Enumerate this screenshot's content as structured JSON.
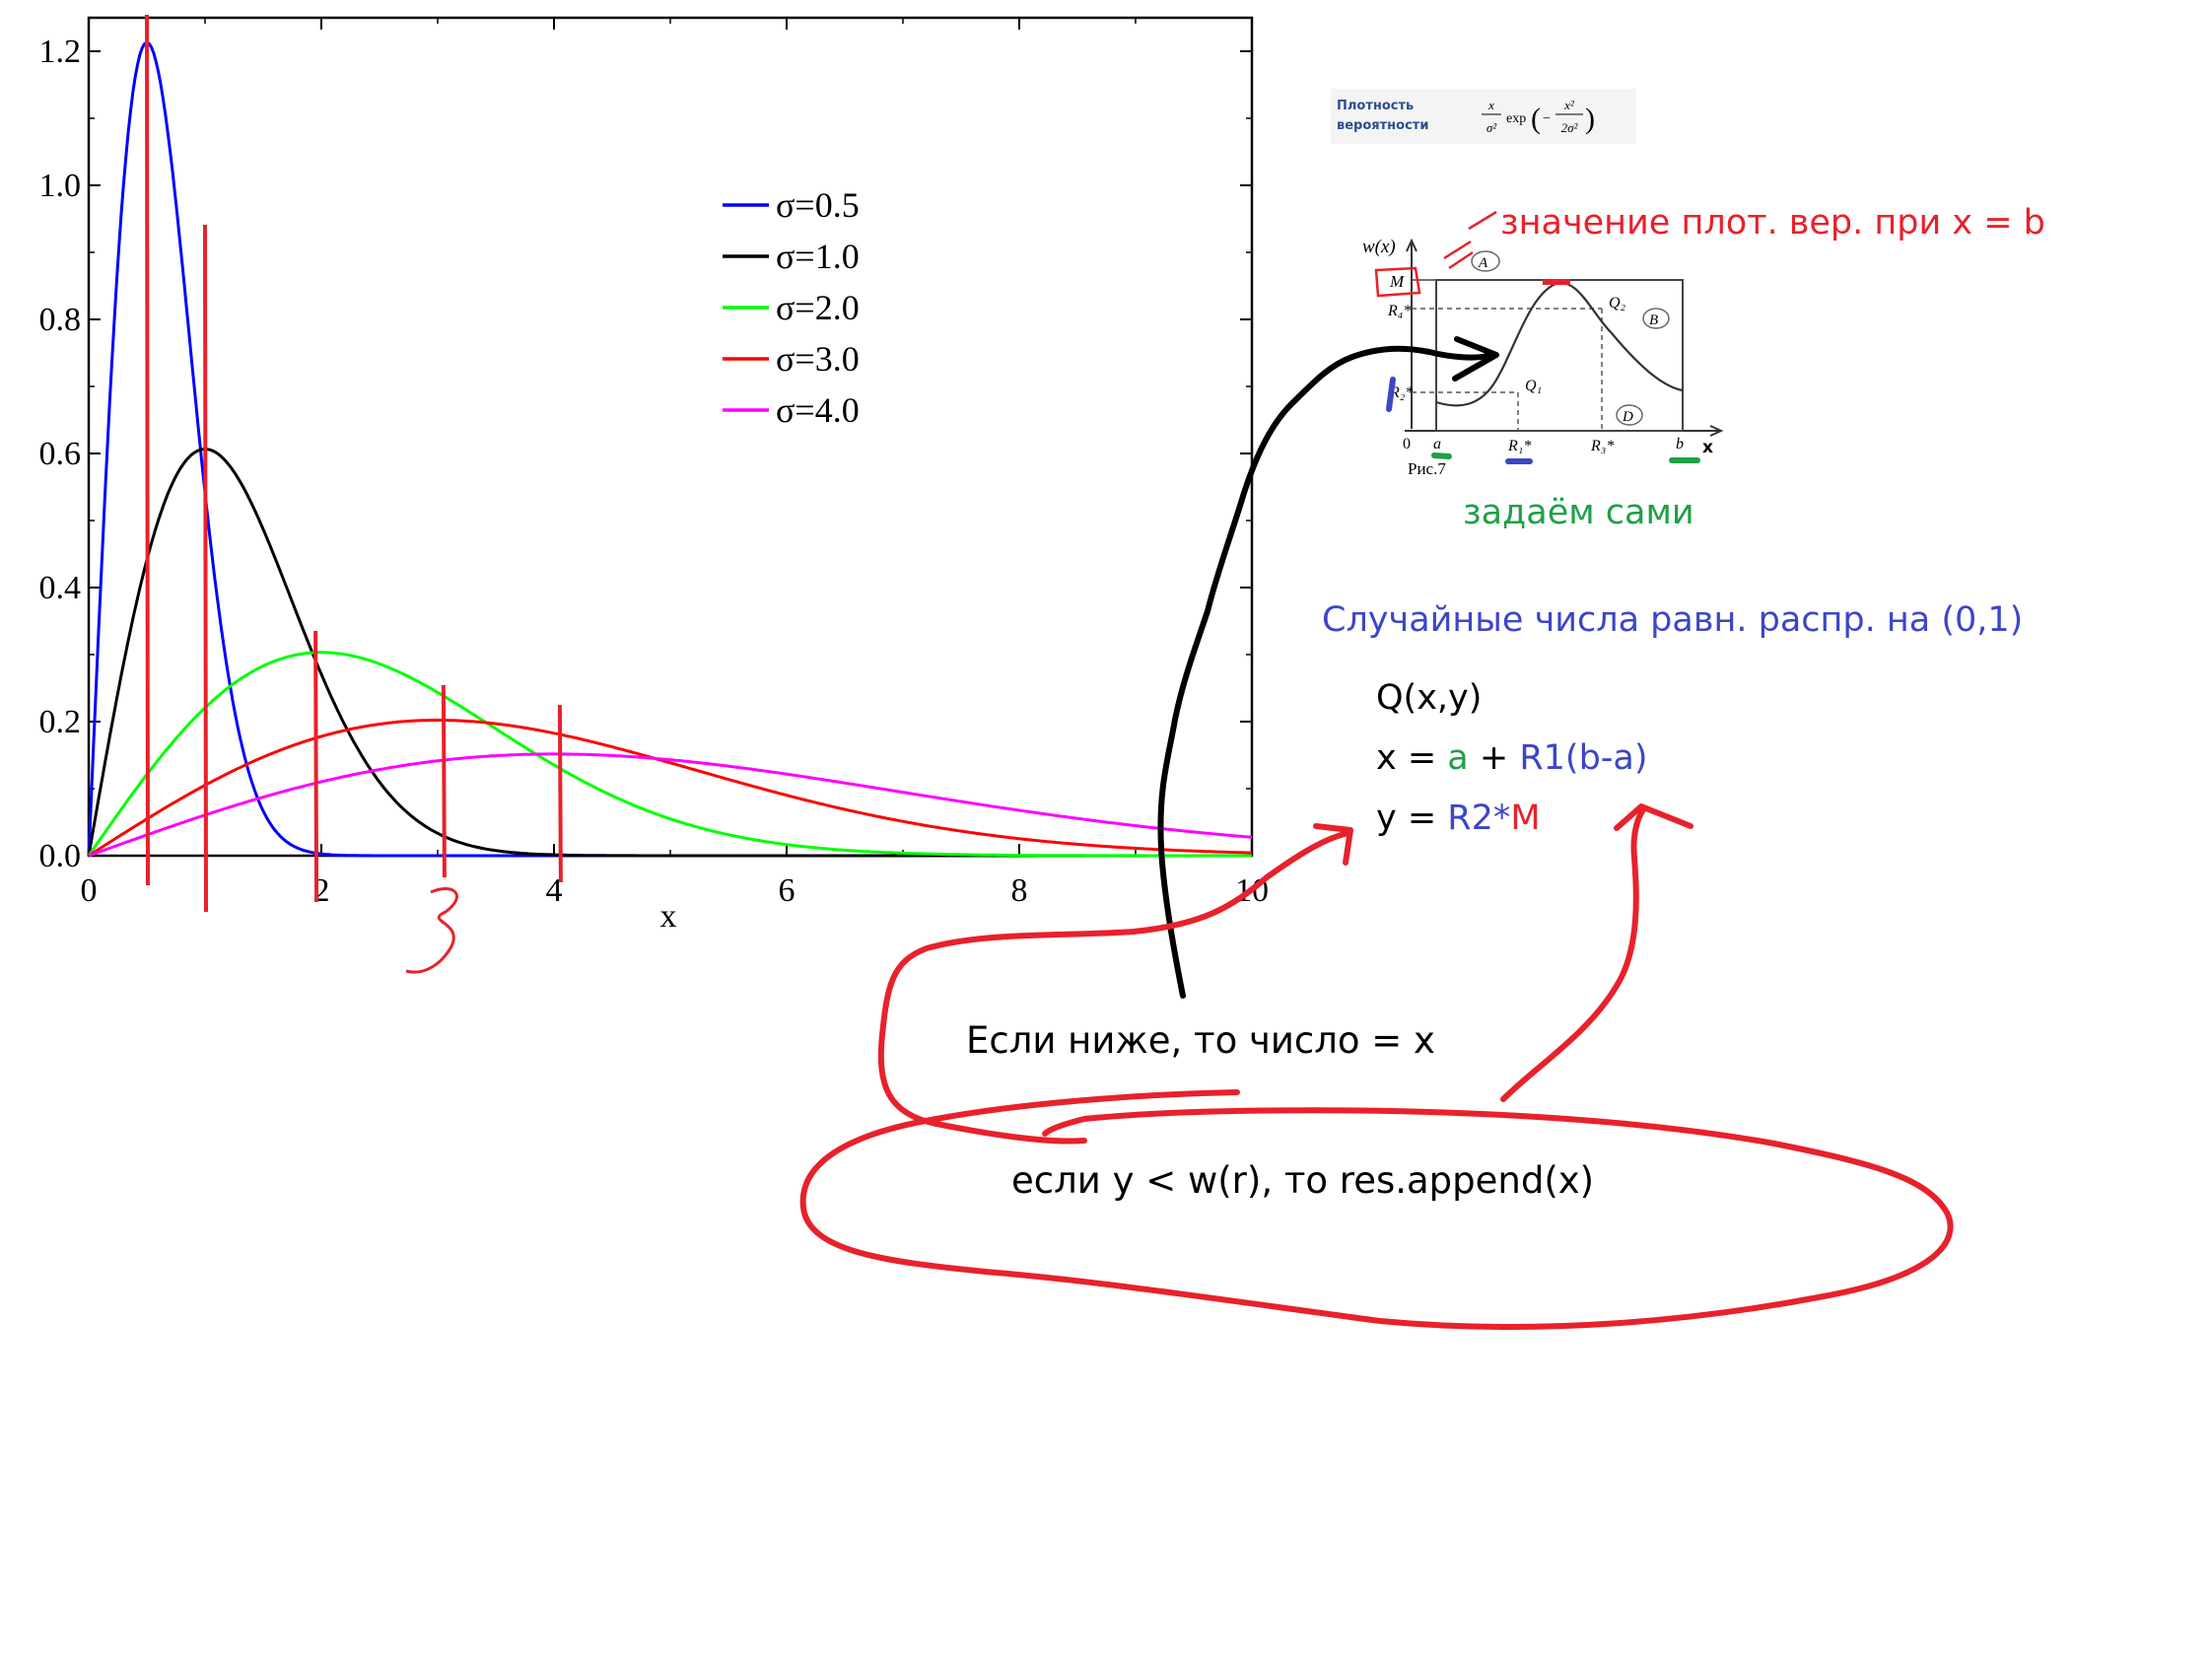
{
  "colors": {
    "axis": "#000000",
    "annotation_red": "#e8212b",
    "annotation_blue": "#3c46c8",
    "annotation_green": "#1fa046",
    "ink_black": "#000000",
    "series_blue": "#0000ff",
    "series_black": "#000000",
    "series_green": "#00ff00",
    "series_red": "#ff0000",
    "series_magenta": "#ff00ff"
  },
  "chart_data": {
    "type": "line",
    "title": "",
    "xlabel": "x",
    "ylabel": "",
    "xlim": [
      0,
      10
    ],
    "ylim": [
      0,
      1.25
    ],
    "x_ticks": [
      "0",
      "2",
      "4",
      "6",
      "8",
      "10"
    ],
    "y_ticks": [
      "0.0",
      "0.2",
      "0.4",
      "0.6",
      "0.8",
      "1.0",
      "1.2"
    ],
    "legend_position": "top-right",
    "function": "Rayleigh density x/σ² · exp(−x²/(2σ²))",
    "series": [
      {
        "name": "σ=0.5",
        "sigma": 0.5,
        "color": "#0000ff"
      },
      {
        "name": "σ=1.0",
        "sigma": 1.0,
        "color": "#000000"
      },
      {
        "name": "σ=2.0",
        "sigma": 2.0,
        "color": "#00ff00"
      },
      {
        "name": "σ=3.0",
        "sigma": 3.0,
        "color": "#ff0000"
      },
      {
        "name": "σ=4.0",
        "sigma": 4.0,
        "color": "#ff00ff"
      }
    ],
    "marker_lines_x": [
      0.5,
      1.0,
      1.95,
      3.05,
      4.05
    ],
    "handwritten_number": "3"
  },
  "formula_box": {
    "label_line1": "Плотность",
    "label_line2": "вероятности",
    "formula_text": "x/σ² exp(−x²/(2σ²))"
  },
  "diagram": {
    "y_label": "w(x)",
    "x_label": "x",
    "origin": "0",
    "fig_caption": "Рис.7",
    "labels": {
      "M": "M",
      "R4": "R₄*",
      "R2": "R₂*",
      "a": "a",
      "R1": "R₁*",
      "R3": "R₃*",
      "b": "b",
      "Q1": "Q₁",
      "Q2": "Q₂",
      "A": "A",
      "B": "B",
      "D": "D"
    }
  },
  "annotations": {
    "max_value": "значение плот. вер. при x = b",
    "we_set": "задаём сами",
    "random_numbers": "Случайные числа равн. распр. на (0,1)",
    "q_line": "Q(x,y)",
    "x_eq": {
      "p1": "x = ",
      "p2": "a",
      "p3": " + ",
      "p4": "R1(b-a)"
    },
    "y_eq": {
      "p1": "y = ",
      "p2": "R2*",
      "p3": "M"
    },
    "if_below": "Если ниже, то число = x",
    "if_y": "если y < w(r), то res.append(x)"
  }
}
